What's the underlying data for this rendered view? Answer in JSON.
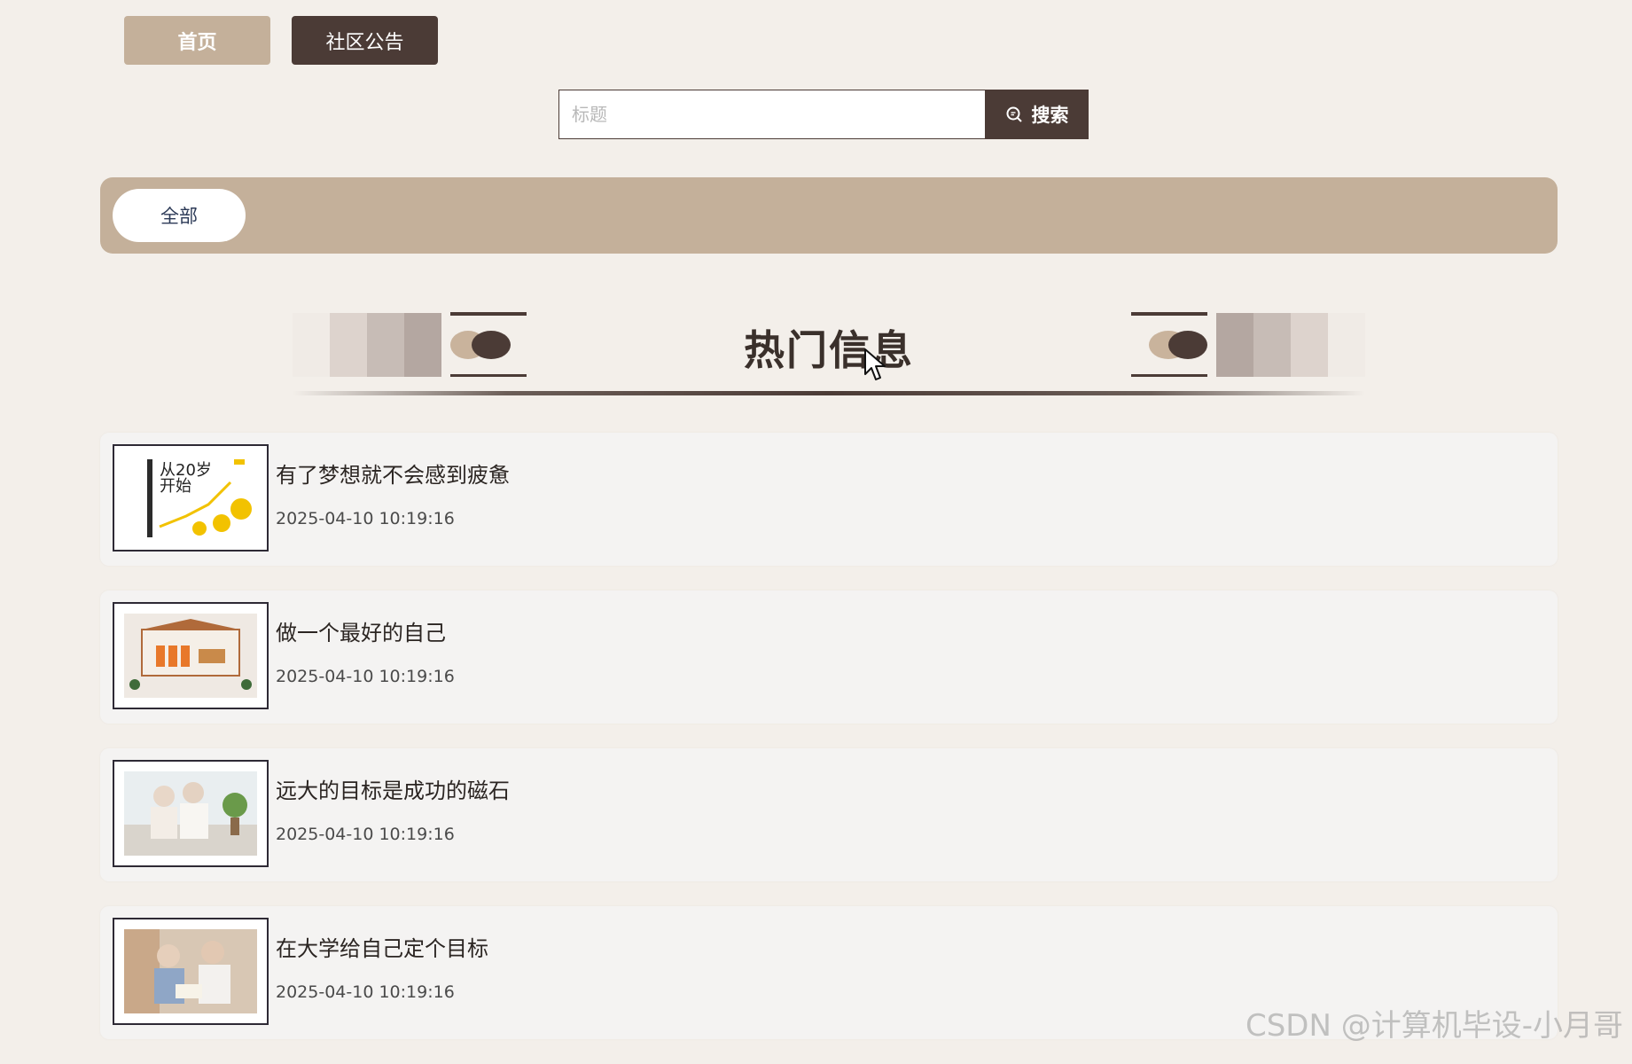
{
  "nav": {
    "home_label": "首页",
    "notice_label": "社区公告"
  },
  "search": {
    "placeholder": "标题",
    "value": "",
    "button_label": "搜索"
  },
  "categories": {
    "all_label": "全部"
  },
  "section": {
    "title": "热门信息"
  },
  "items": [
    {
      "title": "有了梦想就不会感到疲惫",
      "date": "2025-04-10 10:19:16",
      "thumb": "book-cover-image"
    },
    {
      "title": "做一个最好的自己",
      "date": "2025-04-10 10:19:16",
      "thumb": "community-wall-image"
    },
    {
      "title": "远大的目标是成功的磁石",
      "date": "2025-04-10 10:19:16",
      "thumb": "elderly-couple-image"
    },
    {
      "title": "在大学给自己定个目标",
      "date": "2025-04-10 10:19:16",
      "thumb": "elderly-couple-reading-image"
    }
  ],
  "watermark": "CSDN @计算机毕设-小月哥",
  "colors": {
    "page_bg": "#f3efea",
    "accent_tan": "#c4b09a",
    "accent_dark": "#4b3b36",
    "card_bg": "#f4f3f2"
  }
}
